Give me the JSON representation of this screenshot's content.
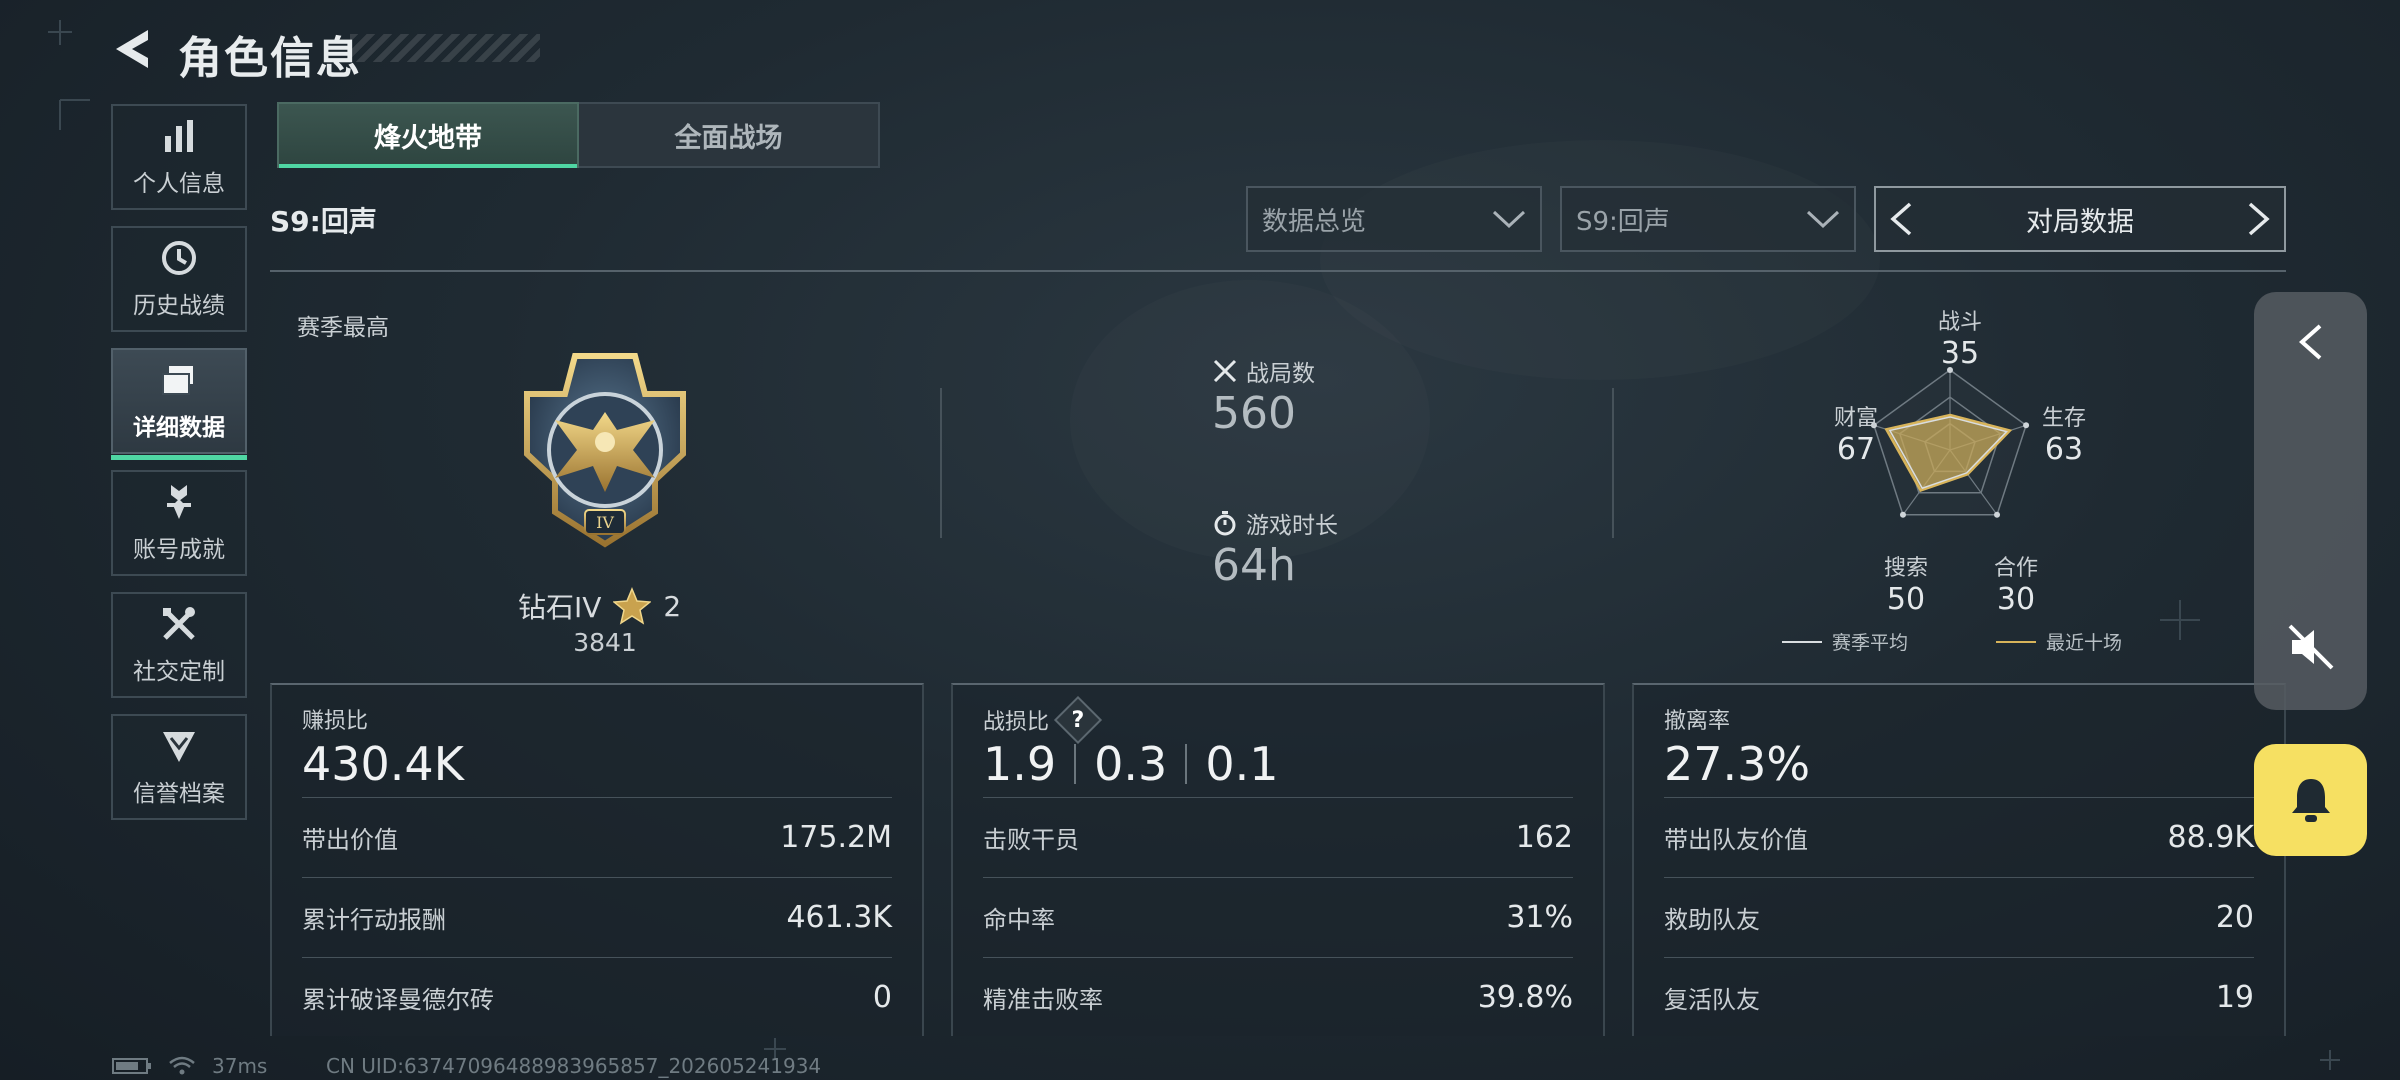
{
  "header": {
    "title": "角色信息"
  },
  "sidebar": {
    "items": [
      {
        "label": "个人信息",
        "icon": "bar-chart-icon",
        "active": false
      },
      {
        "label": "历史战绩",
        "icon": "history-clock-icon",
        "active": false
      },
      {
        "label": "详细数据",
        "icon": "folders-icon",
        "active": true
      },
      {
        "label": "账号成就",
        "icon": "medal-icon",
        "active": false
      },
      {
        "label": "社交定制",
        "icon": "tools-icon",
        "active": false
      },
      {
        "label": "信誉档案",
        "icon": "shield-chevron-icon",
        "active": false
      }
    ]
  },
  "tabs": [
    {
      "label": "烽火地带",
      "active": true
    },
    {
      "label": "全面战场",
      "active": false
    }
  ],
  "season_label": "S9:回声",
  "filters": {
    "overview": "数据总览",
    "season": "S9:回声",
    "mode": "对局数据"
  },
  "summary": {
    "season_best_label": "赛季最高",
    "rank_name": "钻石IV",
    "rank_stars": "2",
    "rank_score": "3841",
    "matches_label": "战局数",
    "matches_value": "560",
    "playtime_label": "游戏时长",
    "playtime_value": "64h"
  },
  "radar": {
    "axes": [
      {
        "label": "战斗",
        "value": "35"
      },
      {
        "label": "生存",
        "value": "63"
      },
      {
        "label": "合作",
        "value": "30"
      },
      {
        "label": "搜索",
        "value": "50"
      },
      {
        "label": "财富",
        "value": "67"
      }
    ],
    "legend_avg": "赛季平均",
    "legend_recent": "最近十场",
    "avg_color": "#d9dde0",
    "recent_color": "#d8b45a"
  },
  "panels": {
    "profit": {
      "title": "赚损比",
      "big": "430.4K",
      "rows": [
        {
          "k": "带出价值",
          "v": "175.2M"
        },
        {
          "k": "累计行动报酬",
          "v": "461.3K"
        },
        {
          "k": "累计破译曼德尔砖",
          "v": "0"
        }
      ]
    },
    "combat": {
      "title": "战损比",
      "help": "?",
      "big1": "1.9",
      "big2": "0.3",
      "big3": "0.1",
      "rows": [
        {
          "k": "击败干员",
          "v": "162"
        },
        {
          "k": "命中率",
          "v": "31%"
        },
        {
          "k": "精准击败率",
          "v": "39.8%"
        }
      ]
    },
    "extract": {
      "title": "撤离率",
      "big": "27.3%",
      "rows": [
        {
          "k": "带出队友价值",
          "v": "88.9K"
        },
        {
          "k": "救助队友",
          "v": "20"
        },
        {
          "k": "复活队友",
          "v": "19"
        }
      ]
    }
  },
  "status": {
    "ping": "37ms",
    "uid": "CN UID:63747096488983965857_202605241934"
  },
  "colors": {
    "accent": "#4fd6a3",
    "bell": "#f6e062"
  }
}
